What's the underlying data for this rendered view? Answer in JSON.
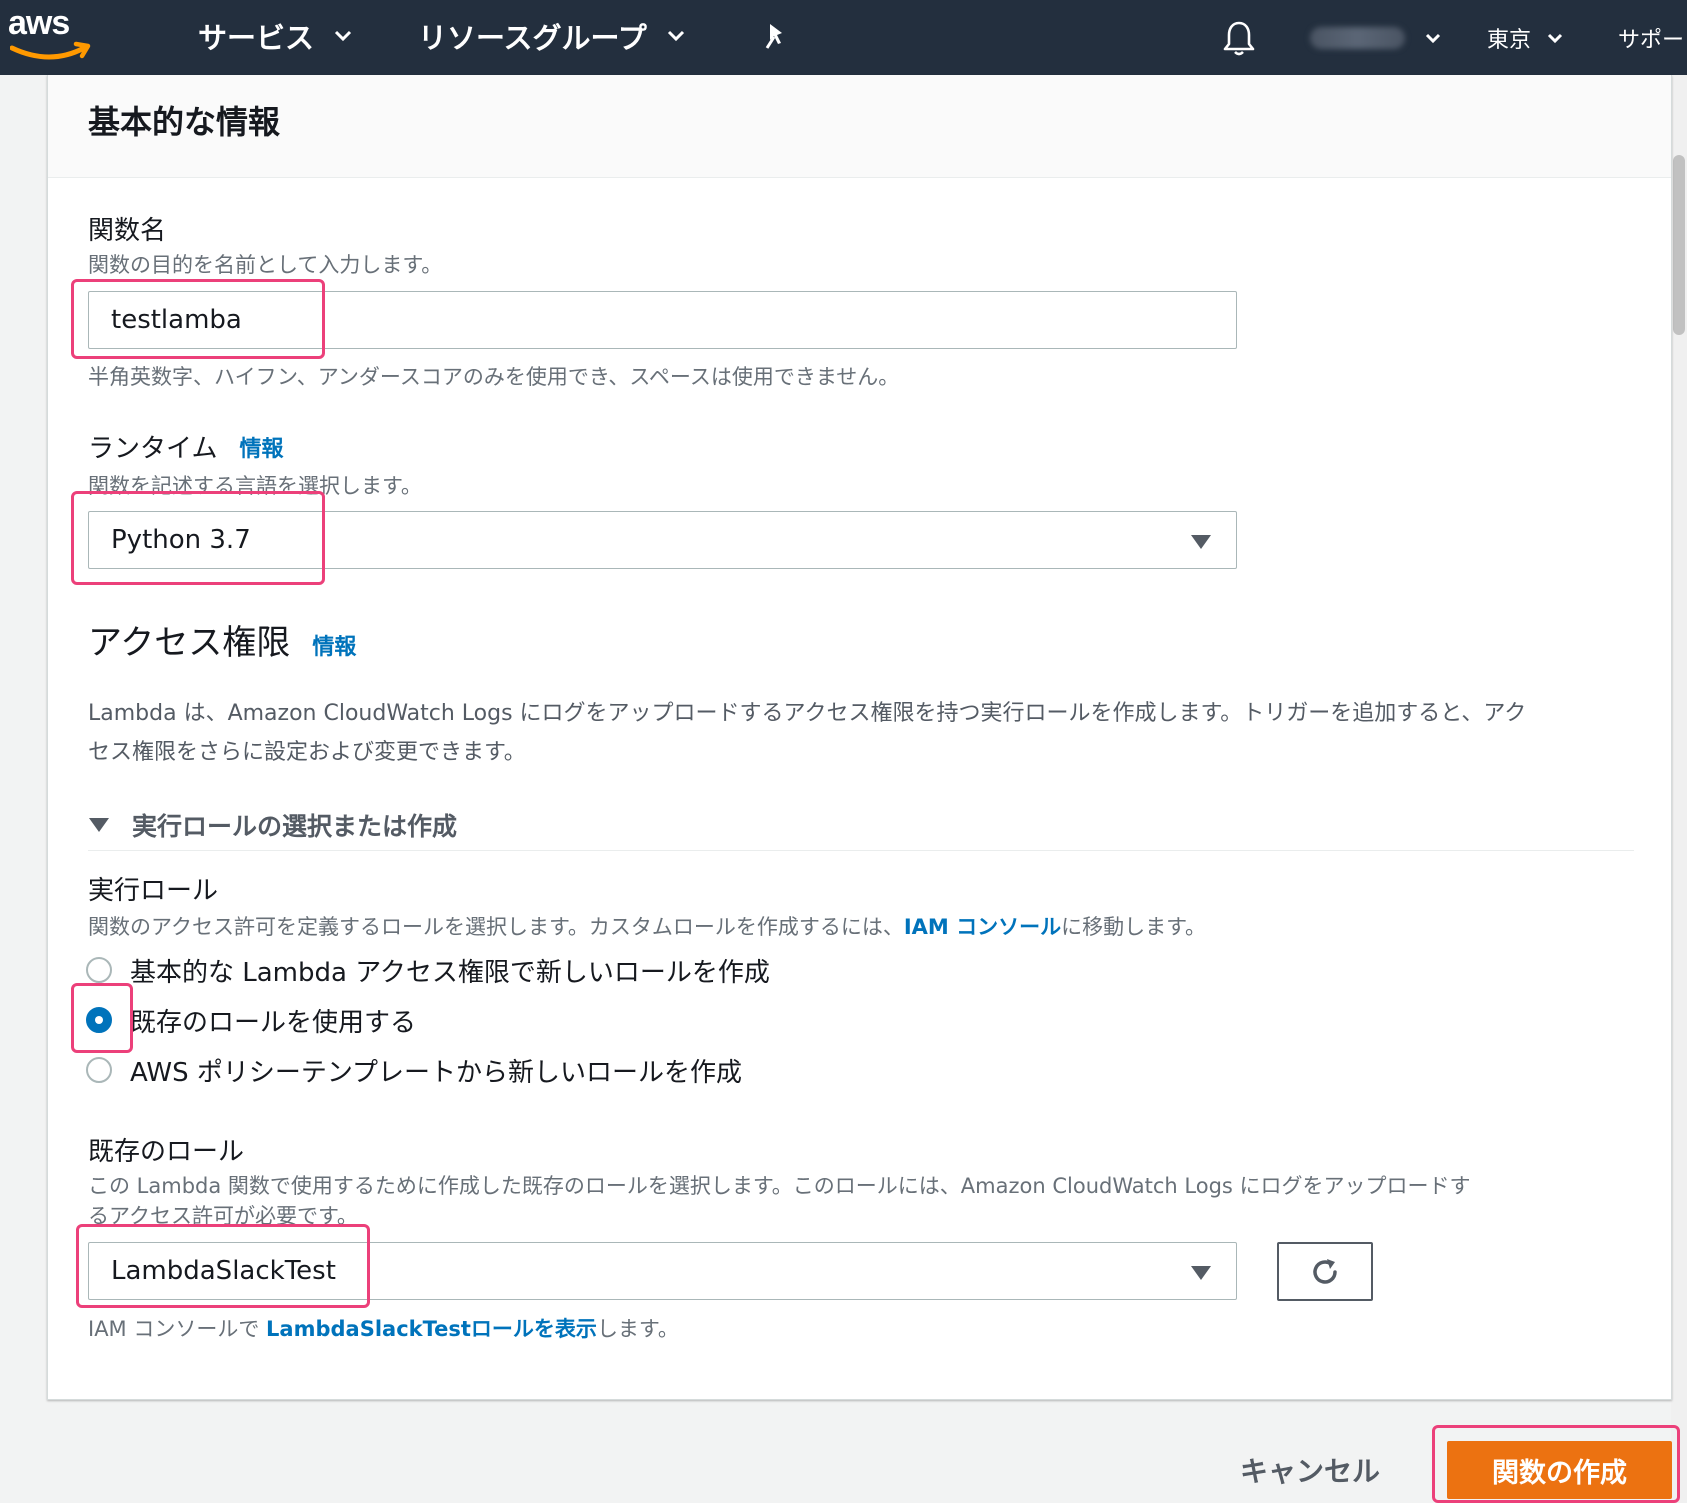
{
  "nav": {
    "logo_text": "aws",
    "services": "サービス",
    "resource_groups": "リソースグループ",
    "region": "東京",
    "support": "サポート"
  },
  "panel": {
    "title": "基本的な情報"
  },
  "function_name": {
    "label": "関数名",
    "description": "関数の目的を名前として入力します。",
    "value": "testlamba",
    "hint": "半角英数字、ハイフン、アンダースコアのみを使用でき、スペースは使用できません。"
  },
  "runtime": {
    "label": "ランタイム",
    "info_link": "情報",
    "description": "関数を記述する言語を選択します。",
    "value": "Python 3.7"
  },
  "access": {
    "heading": "アクセス権限",
    "info_link": "情報",
    "paragraph_line1": "Lambda は、Amazon CloudWatch Logs にログをアップロードするアクセス権限を持つ実行ロールを作成します。トリガーを追加すると、アク",
    "paragraph_line2": "セス権限をさらに設定および変更できます。"
  },
  "execution_role_section": {
    "expander_label": "実行ロールの選択または作成",
    "label": "実行ロール",
    "description_prefix": "関数のアクセス許可を定義するロールを選択します。カスタムロールを作成するには、",
    "description_link": "IAM コンソール",
    "description_suffix": "に移動します。",
    "options": [
      {
        "label": "基本的な Lambda アクセス権限で新しいロールを作成",
        "checked": false
      },
      {
        "label": "既存のロールを使用する",
        "checked": true
      },
      {
        "label": "AWS ポリシーテンプレートから新しいロールを作成",
        "checked": false
      }
    ]
  },
  "existing_role": {
    "label": "既存のロール",
    "description_line1": "この Lambda 関数で使用するために作成した既存のロールを選択します。このロールには、Amazon CloudWatch Logs にログをアップロードす",
    "description_line2": "るアクセス許可が必要です。",
    "value": "LambdaSlackTest",
    "footer_prefix": "IAM コンソールで ",
    "footer_link": "LambdaSlackTestロールを表示",
    "footer_suffix": "します。"
  },
  "footer": {
    "cancel": "キャンセル",
    "create": "関数の作成"
  },
  "colors": {
    "nav_bg": "#232f3e",
    "link": "#0073bb",
    "primary_button": "#ec7211",
    "highlight": "#ec407a"
  }
}
